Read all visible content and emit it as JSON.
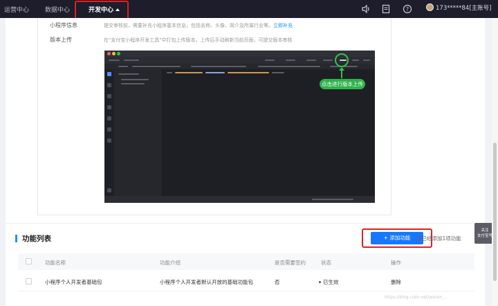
{
  "top_nav": {
    "tabs": [
      "运营中心",
      "数据中心",
      "开发中心"
    ],
    "active_tab": "开发中心",
    "icons": [
      "speaker-icon",
      "document-icon",
      "help-icon"
    ],
    "user": "173*****84[主账号]"
  },
  "info_section": {
    "row1_label": "小程序信息",
    "row1_text": "提交审核前，需要补充小程序基本信息，包括名称、头像、简介及所属行业等。",
    "row1_link": "立即补充",
    "row2_label": "版本上传",
    "row2_text": "在\"支付宝小程序开发工具\"中打包上传版本，上传后手动刷新当前页面，可提交版本审核",
    "ide_callout": "点击进行版本上传"
  },
  "feature_list": {
    "title": "功能列表",
    "add_button": "+ 添加功能",
    "added_note": "您已经添加1项功能",
    "columns": [
      "功能名称",
      "功能介绍",
      "是否需要签约",
      "状态",
      "操作"
    ],
    "rows": [
      {
        "name": "小程序个人开发者基础包",
        "desc": "小程序个人开发者默认开放的基础功能包",
        "sign": "否",
        "status": "已生效",
        "action": "删除"
      }
    ]
  },
  "follow_button": "关注\n支付宝号",
  "watermark": "https://blog.csdn.net/weixin_…",
  "colors": {
    "nav_bg": "#1d1d2c",
    "primary": "#1677ff",
    "highlight": "#e02020",
    "callout_green": "#2eb34a"
  }
}
